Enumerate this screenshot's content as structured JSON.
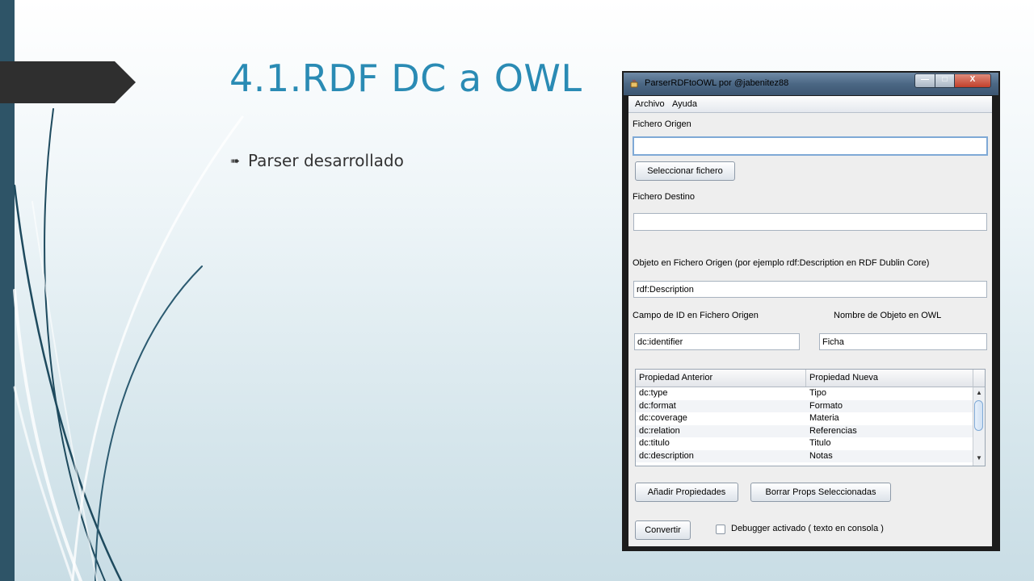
{
  "slide": {
    "title": "4.1.RDF DC a OWL",
    "bullet": "Parser desarrollado",
    "bullet_icon": "arrow-right-icon"
  },
  "window": {
    "title": "ParserRDFtoOWL por @jabenitez88",
    "menu": [
      "Archivo",
      "Ayuda"
    ],
    "fichero_origen_label": "Fichero Origen",
    "fichero_origen_value": "",
    "seleccionar_button": "Seleccionar fichero",
    "fichero_destino_label": "Fichero Destino",
    "fichero_destino_value": "",
    "objeto_label": "Objeto en Fichero Origen (por ejemplo rdf:Description en RDF Dublin Core)",
    "objeto_value": "rdf:Description",
    "campo_id_label": "Campo de ID en Fichero Origen",
    "campo_id_value": "dc:identifier",
    "nombre_objeto_label": "Nombre de Objeto en OWL",
    "nombre_objeto_value": "Ficha",
    "table": {
      "headers": [
        "Propiedad Anterior",
        "Propiedad Nueva"
      ],
      "rows": [
        [
          "dc:type",
          "Tipo"
        ],
        [
          "dc:format",
          "Formato"
        ],
        [
          "dc:coverage",
          "Materia"
        ],
        [
          "dc:relation",
          "Referencias"
        ],
        [
          "dc:titulo",
          "Titulo"
        ],
        [
          "dc:description",
          "Notas"
        ]
      ]
    },
    "anadir_button": "Añadir Propiedades",
    "borrar_button": "Borrar Props Seleccionadas",
    "convertir_button": "Convertir",
    "debugger_label": "Debugger activado ( texto en consola )",
    "debugger_checked": false
  },
  "colors": {
    "title": "#2a8bb4",
    "left_bar": "#2e5467",
    "tab": "#2f2f2f"
  }
}
